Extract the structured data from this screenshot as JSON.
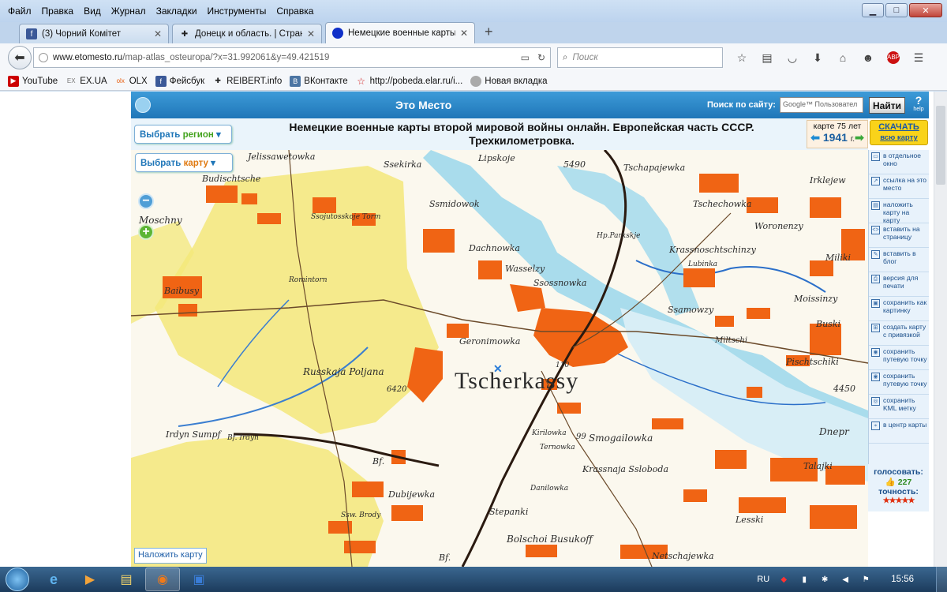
{
  "browser": {
    "menu": [
      "Файл",
      "Правка",
      "Вид",
      "Журнал",
      "Закладки",
      "Инструменты",
      "Справка"
    ],
    "window_controls": {
      "minimize": "▁",
      "maximize": "□",
      "close": "✕"
    },
    "tabs": [
      {
        "title": "(3) Чорний Комітет",
        "icon": "facebook-icon",
        "icon_color": "#3b5998",
        "active": false
      },
      {
        "title": "Донецк и область. | Стран...",
        "icon": "cross-icon",
        "icon_color": "#333333",
        "active": false
      },
      {
        "title": "Немецкие военные карты...",
        "icon": "blue-circle-icon",
        "icon_color": "#1030c8",
        "active": true
      }
    ],
    "new_tab": "+",
    "url": {
      "domain": "www.etomesto.ru",
      "path": "/map-atlas_osteuropa/?x=31.992061&y=49.421519"
    },
    "search_placeholder": "Поиск",
    "bookmarks": [
      {
        "label": "YouTube",
        "icon": "youtube-icon",
        "color": "#cc0000"
      },
      {
        "label": "EX.UA",
        "icon": "exua-icon",
        "color": "#777777"
      },
      {
        "label": "OLX",
        "icon": "olx-icon",
        "color": "#e85c0d"
      },
      {
        "label": "Фейсбук",
        "icon": "facebook-icon",
        "color": "#3b5998"
      },
      {
        "label": "REIBERT.info",
        "icon": "cross-icon",
        "color": "#222222"
      },
      {
        "label": "ВКонтакте",
        "icon": "vk-icon",
        "color": "#4c75a3"
      },
      {
        "label": "http://pobeda.elar.ru/i...",
        "icon": "star-icon",
        "color": "#d02020"
      },
      {
        "label": "Новая вкладка",
        "icon": "globe-icon",
        "color": "#888888"
      }
    ]
  },
  "site": {
    "name": "Это Место",
    "search_label": "Поиск по сайту:",
    "search_placeholder": "Google™ Пользовател",
    "search_button": "Найти",
    "help": "?",
    "help_label": "help",
    "title_line1": "Немецкие военные карты второй мировой войны онлайн. Европейская часть СССР.",
    "title_line2": "Трехкилометровка.",
    "region_btn": {
      "part1": "Выбрать",
      "part2": "регион"
    },
    "map_btn": {
      "part1": "Выбрать",
      "part2": "карту"
    },
    "year_box": {
      "label": "карте 75 лет",
      "year": "1941",
      "suffix": "г."
    },
    "download": {
      "label": "СКАЧАТЬ",
      "sub": "всю карту"
    },
    "overlay_button": "Наложить карту",
    "side_items": [
      "в отдельное окно",
      "ссылка на это место",
      "наложить карту на карту",
      "вставить на страницу",
      "вставить в блог",
      "версия для печати",
      "сохранить как картинку",
      "создать карту с привязкой",
      "сохранить путевую точку",
      "сохранить путевую точку",
      "сохранить KML метку",
      "в центр карты"
    ],
    "votes_label": "голосовать:",
    "votes_count": "227",
    "accuracy_label": "точность:",
    "accuracy_stars": "★★★★★"
  },
  "map_labels": {
    "l1": "Jelissawetowka",
    "l2": "Ssekirka",
    "l3": "Lipskoje",
    "l4": "5490",
    "l5": "Tschapajewka",
    "l6": "Irklejew",
    "l7": "Budischtsche",
    "l8": "Ssmidowok",
    "l9": "Tschechowka",
    "l10": "Woronenzy",
    "l11": "Moschny",
    "l12": "Ssojutosskoje Torm",
    "l13": "Hp.Parkskje",
    "l14": "Krassnoschtschinzy",
    "l15": "Dachnowka",
    "l16": "Wasselzy",
    "l17": "Ssossnowka",
    "l18": "Lubinka",
    "l19": "Miliki",
    "l20": "Baibusy",
    "l21": "Romintorn",
    "l22": "Moissinzy",
    "l23": "Ssamowzy",
    "l24": "Buski",
    "l25": "Geronimowka",
    "l26": "Miltschi",
    "l27": "Pischtschiki",
    "l28": "Russkaja Poljana",
    "l29": "6420",
    "l30": "Tscherkassy",
    "l31": "110",
    "l32": "4450",
    "l33": "Irdyn Sumpf",
    "l34": "Bf. Irdyn",
    "l35": "Kirilowka",
    "l36": "Smogailowka",
    "l37": "Ternowka",
    "l38": "99",
    "l39": "Dnepr",
    "l40": "Bf.",
    "l41": "Krassnaja Ssloboda",
    "l42": "Dubijewka",
    "l43": "Danilowka",
    "l44": "Talajki",
    "l45": "Ssw. Brody",
    "l46": "Stepanki",
    "l47": "Lesski",
    "l48": "Bolschoi Busukoff",
    "l49": "Bf.",
    "l50": "Netschajewka"
  },
  "taskbar": {
    "lang": "RU",
    "time": "15:56",
    "apps": [
      {
        "icon": "ie-icon",
        "glyph": "e"
      },
      {
        "icon": "media-player-icon",
        "glyph": "▶"
      },
      {
        "icon": "explorer-icon",
        "glyph": "▤"
      },
      {
        "icon": "firefox-icon",
        "glyph": "◉"
      },
      {
        "icon": "save-icon",
        "glyph": "▣"
      }
    ],
    "colors": {
      "taskbar": "#2a5078",
      "map_orange": "#f06414",
      "map_yellow": "#f3e87a",
      "water": "#a9dcec"
    }
  }
}
